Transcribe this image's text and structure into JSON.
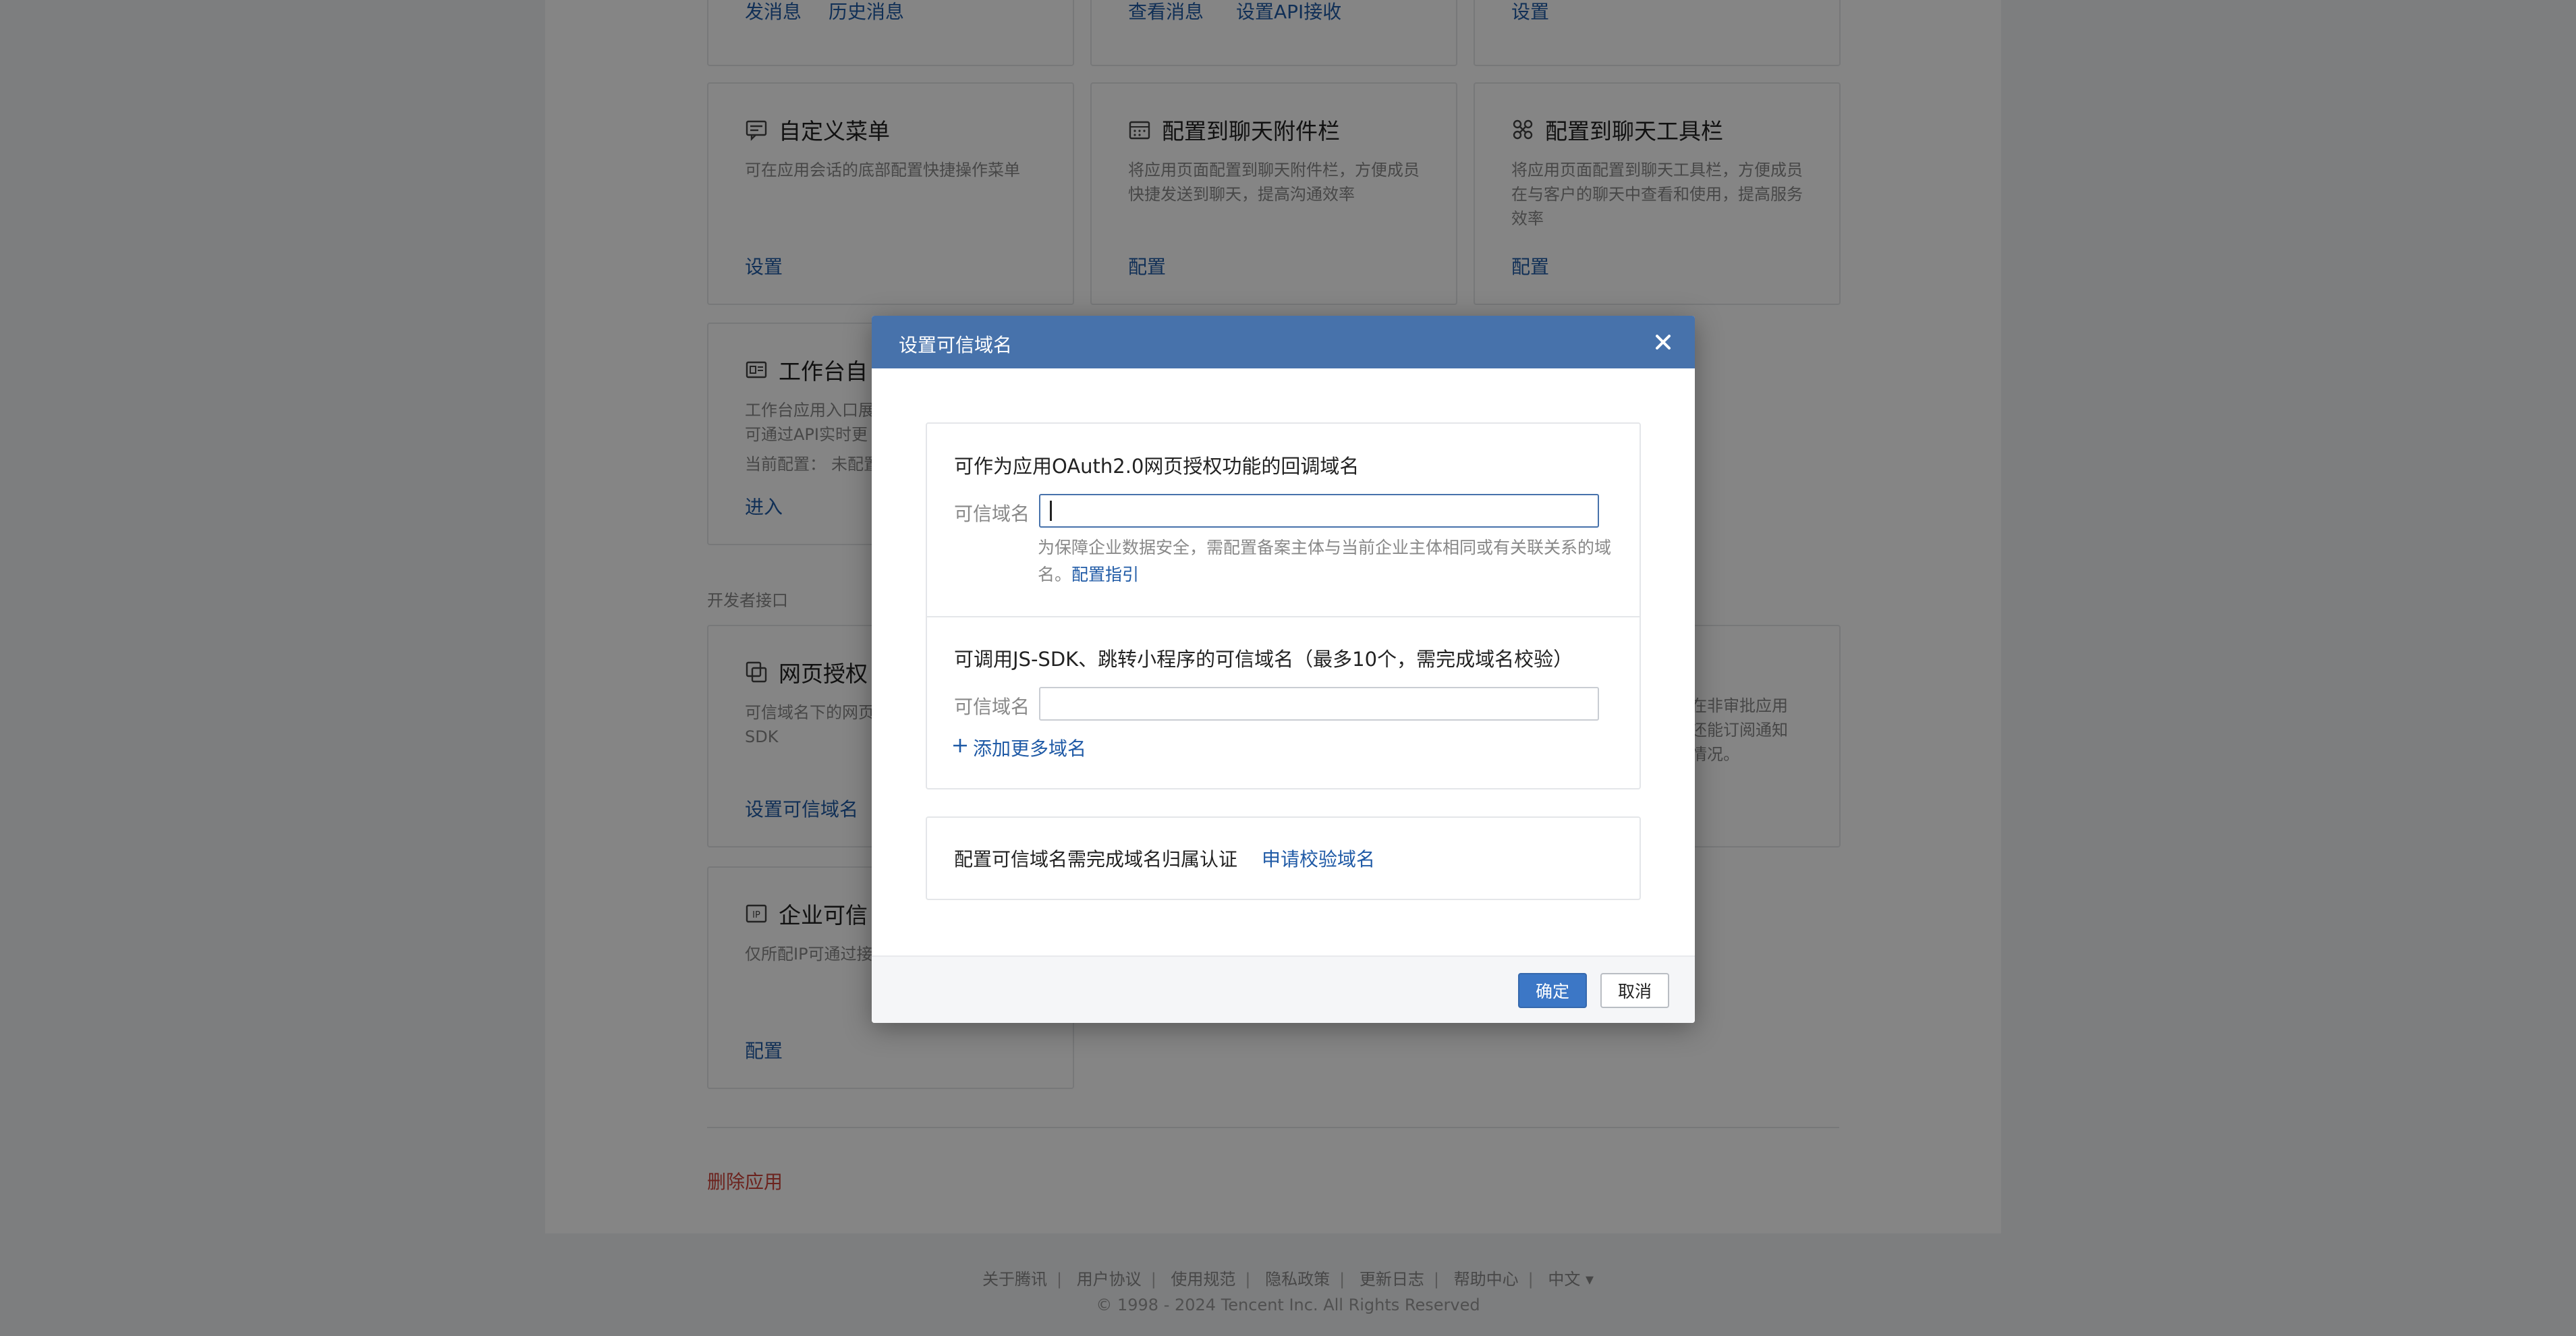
{
  "bg": {
    "top_row": [
      {
        "links": [
          "发消息",
          "历史消息"
        ]
      },
      {
        "links": [
          "查看消息",
          "设置API接收"
        ]
      },
      {
        "links": [
          "设置"
        ]
      }
    ],
    "cards_row2": [
      {
        "title": "自定义菜单",
        "icon": "menu-icon",
        "desc": "可在应用会话的底部配置快捷操作菜单",
        "link": "设置"
      },
      {
        "title": "配置到聊天附件栏",
        "icon": "attachment-grid-icon",
        "desc": "将应用页面配置到聊天附件栏，方便成员快捷发送到聊天，提高沟通效率",
        "link": "配置"
      },
      {
        "title": "配置到聊天工具栏",
        "icon": "toolbar-icon",
        "desc": "将应用页面配置到聊天工具栏，方便成员在与客户的聊天中查看和使用，提高服务效率",
        "link": "配置"
      }
    ],
    "workbench": {
      "title": "工作台自",
      "icon": "workbench-icon",
      "desc": "工作台应用入口展\n可通过API实时更",
      "config_label": "当前配置：",
      "config_value": "未配置",
      "link": "进入"
    },
    "section_label": "开发者接口",
    "web_auth": {
      "title": "网页授权",
      "icon": "web-auth-icon",
      "desc": "可信域名下的网页\nSDK",
      "link": "设置可信域名"
    },
    "right_card_desc": "在非审批应用\n还能订阅通知\n情况。",
    "trusted_ip": {
      "title": "企业可信",
      "icon": "ip-icon",
      "desc": "仅所配IP可通过接",
      "link": "配置"
    },
    "delete_app": "删除应用",
    "footer": {
      "links": [
        "关于腾讯",
        "用户协议",
        "使用规范",
        "隐私政策",
        "更新日志",
        "帮助中心",
        "中文 ▾"
      ],
      "copyright": "© 1998 - 2024 Tencent Inc. All Rights Reserved"
    }
  },
  "modal": {
    "title": "设置可信域名",
    "section1": {
      "title": "可作为应用OAuth2.0网页授权功能的回调域名",
      "field_label": "可信域名",
      "value": "",
      "hint": "为保障企业数据安全，需配置备案主体与当前企业主体相同或有关联关系的域名。",
      "hint_link": "配置指引"
    },
    "section2": {
      "title": "可调用JS-SDK、跳转小程序的可信域名（最多10个，需完成域名校验）",
      "field_label": "可信域名",
      "value": "",
      "add_more": "添加更多域名"
    },
    "section3": {
      "text": "配置可信域名需完成域名归属认证",
      "link": "申请校验域名"
    },
    "confirm": "确定",
    "cancel": "取消"
  },
  "colors": {
    "header": "#4772ab",
    "primary_button": "#3c77c6",
    "link": "#1f5aa6",
    "danger": "#d0433a"
  }
}
